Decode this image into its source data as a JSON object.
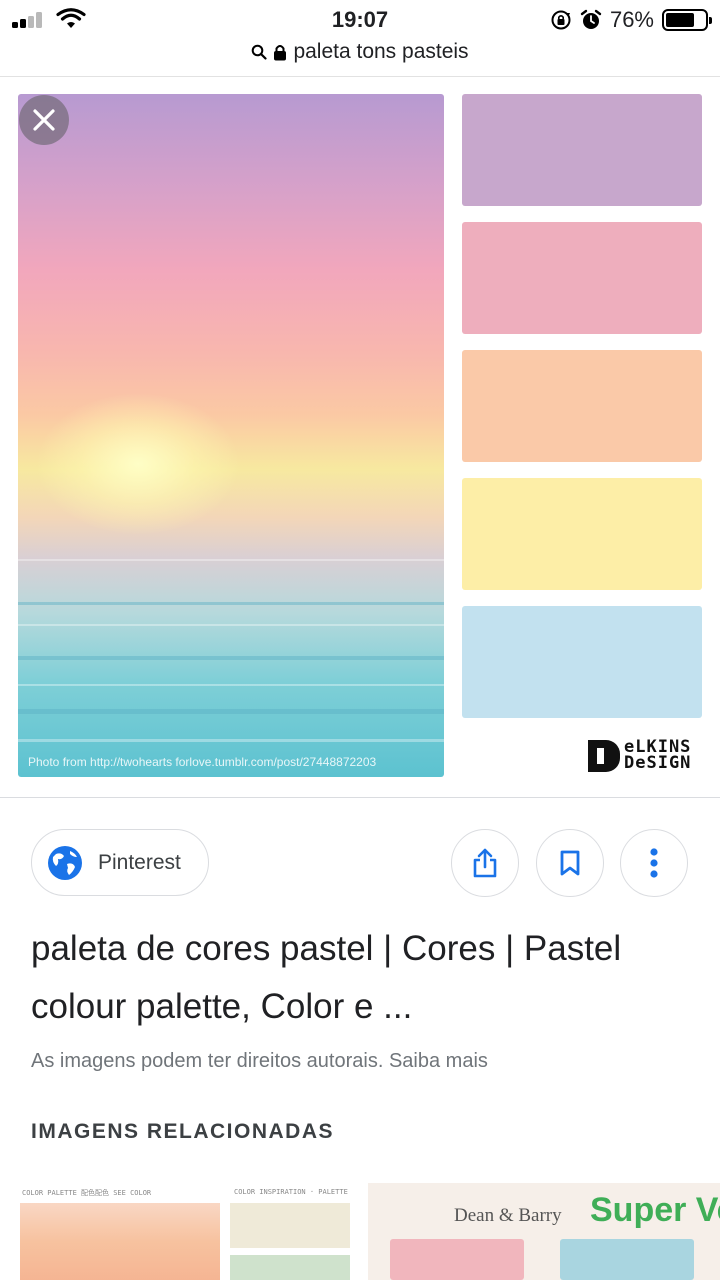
{
  "status_bar": {
    "time": "19:07",
    "battery": "76%",
    "battery_level": 0.76,
    "icons": [
      "signal-icon",
      "wifi-icon",
      "rotation-lock-icon",
      "alarm-icon",
      "battery-icon"
    ]
  },
  "url_bar": {
    "query": "paleta tons pasteis",
    "icons": [
      "search-icon",
      "lock-icon"
    ]
  },
  "viewer": {
    "photo_credit": "Photo from http://twohearts forlove.tumblr.com/post/27448872203",
    "swatch_colors": [
      "#c7a7cc",
      "#eeaebd",
      "#fac9a8",
      "#fdeea7",
      "#c2e1ef"
    ],
    "logo_text_line1": "eLKINS",
    "logo_text_line2": "DeSIGN"
  },
  "source": {
    "label": "Pinterest"
  },
  "actions": [
    "share-button",
    "save-button",
    "more-options-button"
  ],
  "result": {
    "title": "paleta de cores pastel | Cores | Pastel colour palette, Color e ...",
    "copyright": "As imagens podem ter direitos autorais. Saiba mais"
  },
  "related": {
    "heading": "IMAGENS RELACIONADAS",
    "thumb1_caption_left": "COLOR PALETTE 配色配色 SEE COLOR",
    "thumb1_caption_right": "COLOR INSPIRATION · PALETTE",
    "thumb2_brand": "Dean & Barry",
    "thumb2_title": "Super Vel"
  },
  "colors": {
    "accent_blue": "#1a73e8",
    "text_primary": "#202124",
    "text_secondary": "#70757a",
    "border": "#dadce0"
  }
}
